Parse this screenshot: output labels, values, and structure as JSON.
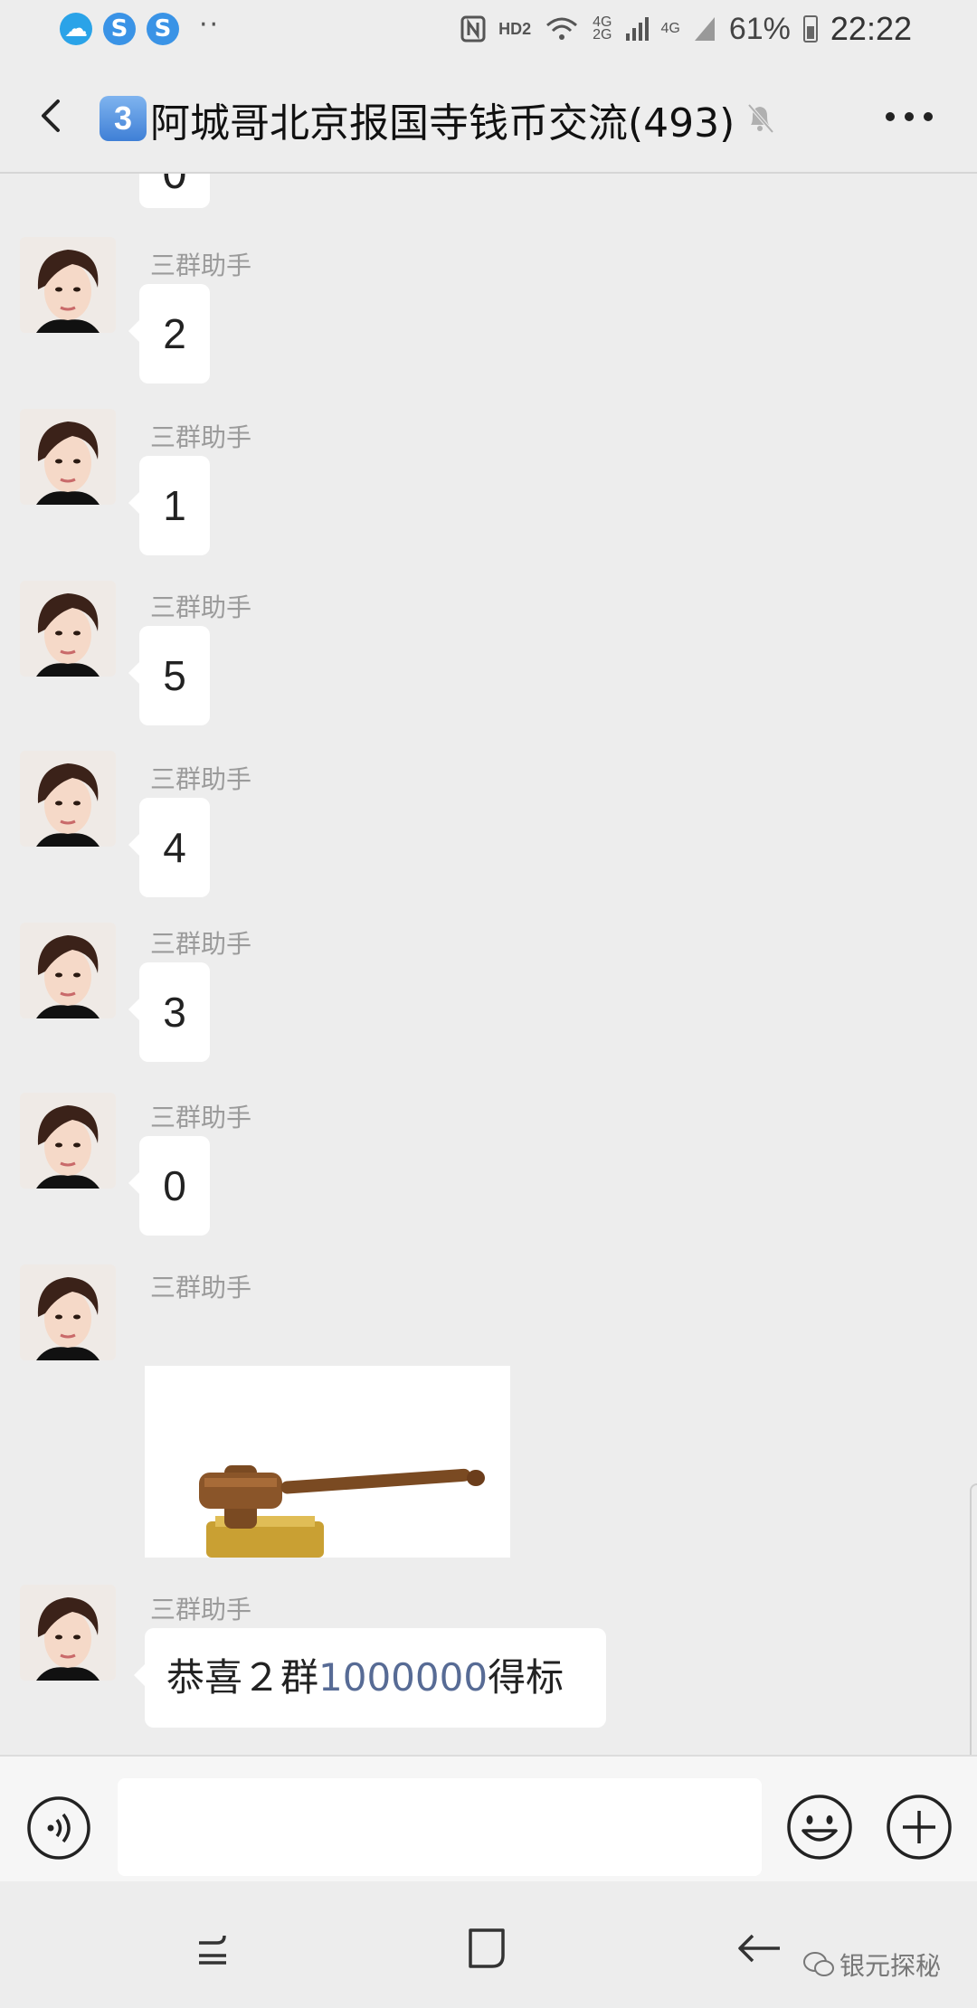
{
  "status_bar": {
    "app_icon_glyph": "S",
    "dots": "··",
    "hd": "HD2",
    "signal1": "4G",
    "signal2": "2G",
    "signal3": "4G",
    "battery": "61%",
    "time": "22:22",
    "icons": [
      "weather-app-icon",
      "sogou-icon",
      "sogou-icon",
      "nfc-icon",
      "wifi-icon",
      "signal-icon",
      "battery-icon"
    ]
  },
  "header": {
    "badge": "3",
    "title": "阿城哥北京报国寺钱币交流(493)",
    "icons": [
      "back-arrow-icon",
      "mute-bell-icon",
      "more-dots-icon"
    ]
  },
  "messages": [
    {
      "sender": "三群助手",
      "text": "2"
    },
    {
      "sender": "三群助手",
      "text": "1"
    },
    {
      "sender": "三群助手",
      "text": "5"
    },
    {
      "sender": "三群助手",
      "text": "4"
    },
    {
      "sender": "三群助手",
      "text": "3"
    },
    {
      "sender": "三群助手",
      "text": "0"
    },
    {
      "sender": "三群助手",
      "image": "gavel-image"
    },
    {
      "sender": "三群助手",
      "text_pre": "恭喜２群",
      "text_highlight": "1000000",
      "text_post": "得标"
    }
  ],
  "partial_top_message": "0",
  "input_bar": {
    "icons": [
      "voice-icon",
      "emoji-icon",
      "plus-icon"
    ],
    "placeholder": ""
  },
  "nav_bar": {
    "icons": [
      "recent-apps-icon",
      "home-icon",
      "back-icon"
    ],
    "watermark": "银元探秘"
  },
  "colors": {
    "background": "#ededed",
    "bubble": "#ffffff",
    "sender_name": "#9b9b9b",
    "link_highlight": "#576b95"
  }
}
